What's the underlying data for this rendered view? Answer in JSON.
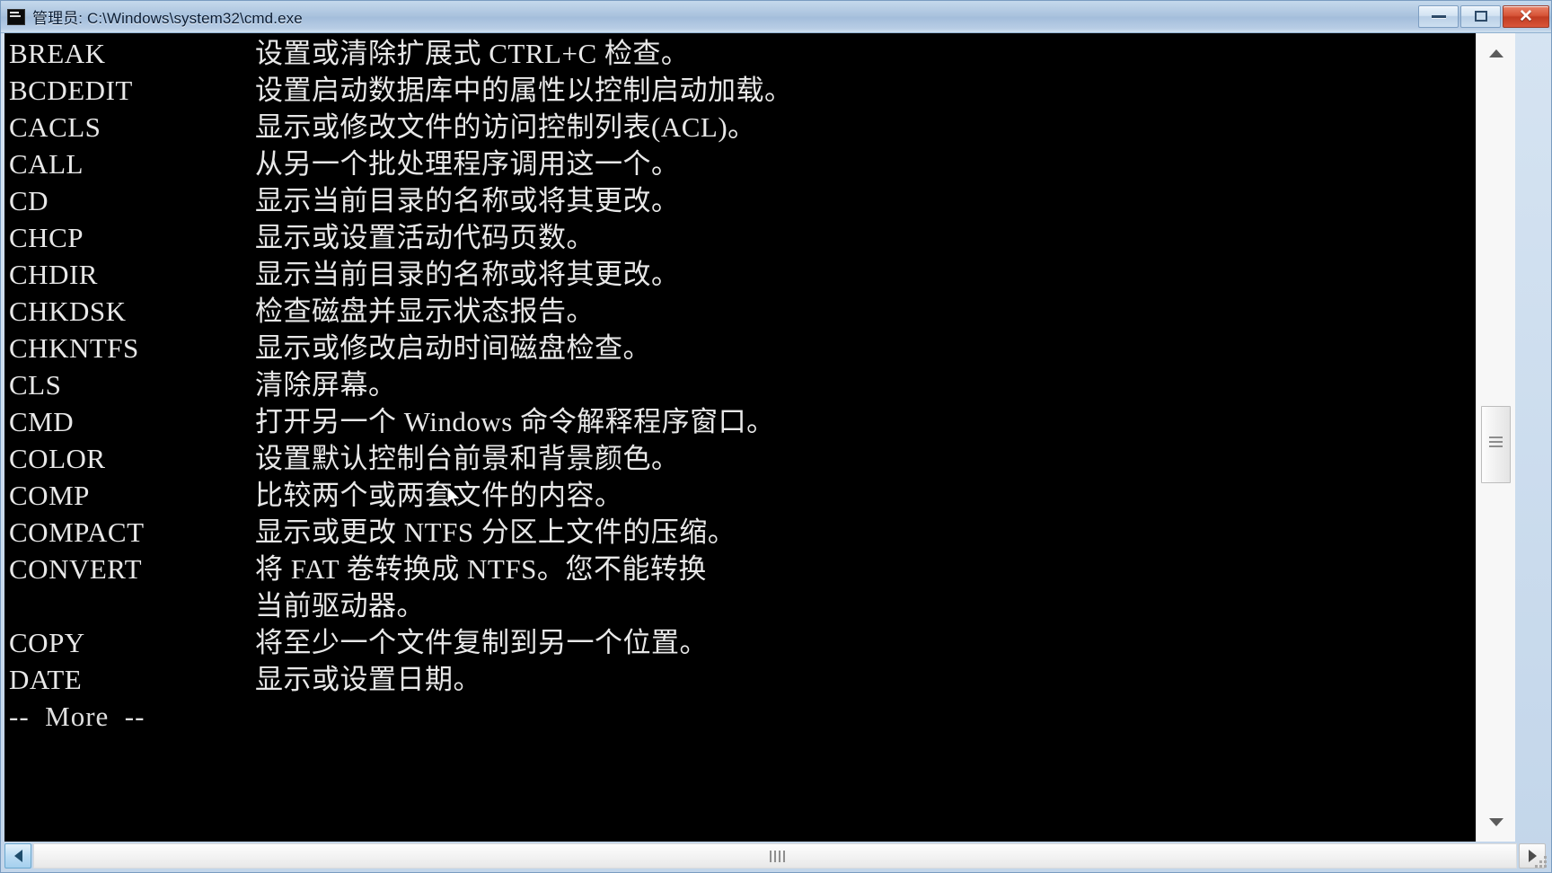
{
  "window": {
    "title": "管理员: C:\\Windows\\system32\\cmd.exe",
    "icon": "cmd-console-icon",
    "colors": {
      "titlebar_top": "#c5d9ec",
      "titlebar_bottom": "#cfe0f0",
      "console_bg": "#000000",
      "console_fg": "#e8e8e8",
      "close_button": "#c13c22",
      "scrollbar_track": "#f7f7f7"
    },
    "controls": {
      "minimize_label": "–",
      "maximize_label": "□",
      "close_label": "✕"
    }
  },
  "console": {
    "lines": [
      {
        "cmd": "BREAK",
        "desc": "设置或清除扩展式 CTRL+C 检查。"
      },
      {
        "cmd": "BCDEDIT",
        "desc": "设置启动数据库中的属性以控制启动加载。"
      },
      {
        "cmd": "CACLS",
        "desc": "显示或修改文件的访问控制列表(ACL)。"
      },
      {
        "cmd": "CALL",
        "desc": "从另一个批处理程序调用这一个。"
      },
      {
        "cmd": "CD",
        "desc": "显示当前目录的名称或将其更改。"
      },
      {
        "cmd": "CHCP",
        "desc": "显示或设置活动代码页数。"
      },
      {
        "cmd": "CHDIR",
        "desc": "显示当前目录的名称或将其更改。"
      },
      {
        "cmd": "CHKDSK",
        "desc": "检查磁盘并显示状态报告。"
      },
      {
        "cmd": "CHKNTFS",
        "desc": "显示或修改启动时间磁盘检查。"
      },
      {
        "cmd": "CLS",
        "desc": "清除屏幕。"
      },
      {
        "cmd": "CMD",
        "desc": "打开另一个 Windows 命令解释程序窗口。"
      },
      {
        "cmd": "COLOR",
        "desc": "设置默认控制台前景和背景颜色。"
      },
      {
        "cmd": "COMP",
        "desc": "比较两个或两套文件的内容。"
      },
      {
        "cmd": "COMPACT",
        "desc": "显示或更改 NTFS 分区上文件的压缩。"
      },
      {
        "cmd": "CONVERT",
        "desc": "将 FAT 卷转换成 NTFS。您不能转换"
      },
      {
        "cmd": "",
        "desc": "当前驱动器。"
      },
      {
        "cmd": "COPY",
        "desc": "将至少一个文件复制到另一个位置。"
      },
      {
        "cmd": "DATE",
        "desc": "显示或设置日期。"
      }
    ],
    "more_prompt": "--  More  --"
  },
  "scrollbars": {
    "vertical": {
      "up_arrow": "▲",
      "down_arrow": "▼",
      "thumb_position_percent": 48
    },
    "horizontal": {
      "left_arrow": "◀",
      "right_arrow": "▶",
      "thumb_position_percent": 0
    }
  }
}
